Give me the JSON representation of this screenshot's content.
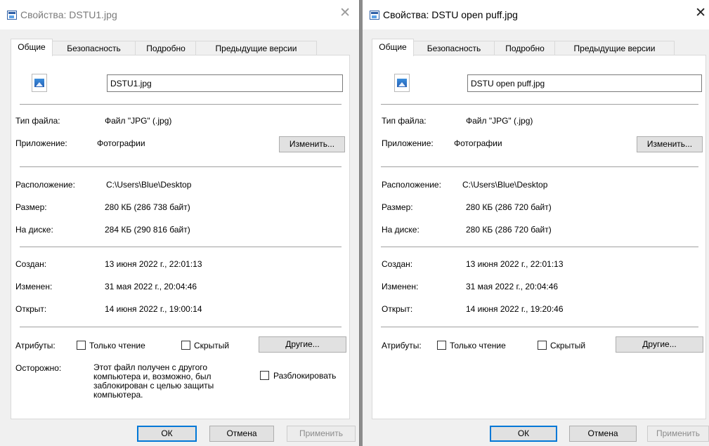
{
  "dialogs": [
    {
      "title": "Свойства: DSTU1.jpg",
      "close_glyph": "✕",
      "tabs": [
        "Общие",
        "Безопасность",
        "Подробно",
        "Предыдущие версии"
      ],
      "filename": "DSTU1.jpg",
      "type_label": "Тип файла:",
      "type_value": "Файл \"JPG\" (.jpg)",
      "app_label": "Приложение:",
      "app_value": "Фотографии",
      "change_button": "Изменить...",
      "location_label": "Расположение:",
      "location_value": "C:\\Users\\Blue\\Desktop",
      "size_label": "Размер:",
      "size_value": "280 КБ (286 738 байт)",
      "disk_label": "На диске:",
      "disk_value": "284 КБ (290 816 байт)",
      "created_label": "Создан:",
      "created_value": "13 июня 2022 г., 22:01:13",
      "modified_label": "Изменен:",
      "modified_value": "31 мая 2022 г., 20:04:46",
      "opened_label": "Открыт:",
      "opened_value": "14 июня 2022 г., 19:00:14",
      "attributes_label": "Атрибуты:",
      "readonly_label": "Только чтение",
      "hidden_label": "Скрытый",
      "other_button": "Другие...",
      "warning_label": "Осторожно:",
      "warning_text": "Этот файл получен с другого\nкомпьютера и, возможно, был\nзаблокирован с целью защиты\nкомпьютера.",
      "unblock_label": "Разблокировать",
      "ok": "ОК",
      "cancel": "Отмена",
      "apply": "Применить"
    },
    {
      "title": "Свойства: DSTU open puff.jpg",
      "close_glyph": "✕",
      "tabs": [
        "Общие",
        "Безопасность",
        "Подробно",
        "Предыдущие версии"
      ],
      "filename": "DSTU open puff.jpg",
      "type_label": "Тип файла:",
      "type_value": "Файл \"JPG\" (.jpg)",
      "app_label": "Приложение:",
      "app_value": "Фотографии",
      "change_button": "Изменить...",
      "location_label": "Расположение:",
      "location_value": "C:\\Users\\Blue\\Desktop",
      "size_label": "Размер:",
      "size_value": "280 КБ (286 720 байт)",
      "disk_label": "На диске:",
      "disk_value": "280 КБ (286 720 байт)",
      "created_label": "Создан:",
      "created_value": "13 июня 2022 г., 22:01:13",
      "modified_label": "Изменен:",
      "modified_value": "31 мая 2022 г., 20:04:46",
      "opened_label": "Открыт:",
      "opened_value": "14 июня 2022 г., 19:20:46",
      "attributes_label": "Атрибуты:",
      "readonly_label": "Только чтение",
      "hidden_label": "Скрытый",
      "other_button": "Другие...",
      "ok": "ОК",
      "cancel": "Отмена",
      "apply": "Применить"
    }
  ],
  "colors": {
    "window_bg": "#f0f0f0",
    "panel_bg": "#ffffff",
    "accent": "#0078d7"
  },
  "icons": [
    "app-icon",
    "image-file-icon",
    "close-icon"
  ]
}
